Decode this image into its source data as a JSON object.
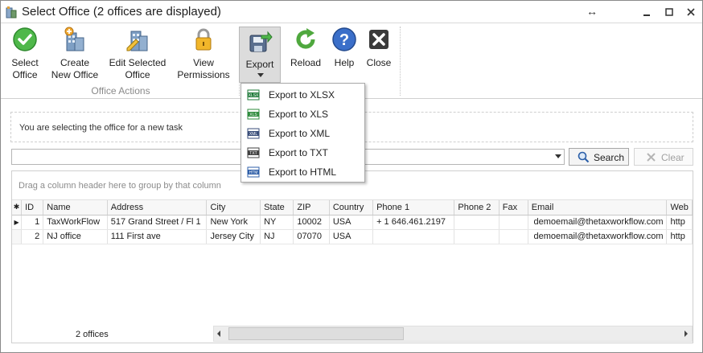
{
  "window": {
    "title": "Select Office (2 offices are displayed)",
    "restore_glyph": "↔",
    "minimize_glyph": "▭",
    "maximize_glyph": "□",
    "close_glyph": "✕"
  },
  "ribbon": {
    "buttons": [
      {
        "label": "Select\nOffice",
        "icon": "check-icon"
      },
      {
        "label": "Create\nNew Office",
        "icon": "building-add-icon"
      },
      {
        "label": "Edit Selected\nOffice",
        "icon": "building-edit-icon"
      },
      {
        "label": "View\nPermissions",
        "icon": "lock-icon"
      },
      {
        "label": "Export",
        "icon": "export-disk-icon"
      },
      {
        "label": "Reload",
        "icon": "reload-icon"
      },
      {
        "label": "Help",
        "icon": "help-icon"
      },
      {
        "label": "Close",
        "icon": "close-icon"
      }
    ],
    "group_label": "Office Actions"
  },
  "export_menu": {
    "items": [
      {
        "label": "Export to XLSX",
        "icon_text": "XLSX",
        "color": "#1f7a3a"
      },
      {
        "label": "Export to XLS",
        "icon_text": "XLS",
        "color": "#2e8b3d"
      },
      {
        "label": "Export to XML",
        "icon_text": "XML",
        "color": "#3a4e7a"
      },
      {
        "label": "Export to TXT",
        "icon_text": "TXT",
        "color": "#404040"
      },
      {
        "label": "Export to HTML",
        "icon_text": "HTM",
        "color": "#2f5fa8"
      }
    ]
  },
  "info": {
    "text": "You are selecting the office for a new task"
  },
  "search": {
    "value": "",
    "search_label": "Search",
    "clear_label": "Clear"
  },
  "grid": {
    "group_hint": "Drag a column header here to group by that column",
    "columns": [
      "ID",
      "Name",
      "Address",
      "City",
      "State",
      "ZIP",
      "Country",
      "Phone 1",
      "Phone 2",
      "Fax",
      "Email",
      "Web"
    ],
    "rows": [
      {
        "indicator": "▶",
        "cells": [
          "1",
          "TaxWorkFlow",
          "517 Grand Street / Fl 1",
          "New York",
          "NY",
          "10002",
          "USA",
          "+ 1 646.461.2197",
          "",
          "",
          "demoemail@thetaxworkflow.com",
          "http"
        ]
      },
      {
        "indicator": "",
        "cells": [
          "2",
          "NJ office",
          "111 First ave",
          "Jersey City",
          "NJ",
          "07070",
          "USA",
          "",
          "",
          "",
          "demoemail@thetaxworkflow.com",
          "http"
        ]
      }
    ],
    "footer_count": "2 offices"
  },
  "colors": {
    "accent_green": "#3aa53a",
    "help_blue": "#3b6fc9",
    "close_dark": "#333333"
  }
}
